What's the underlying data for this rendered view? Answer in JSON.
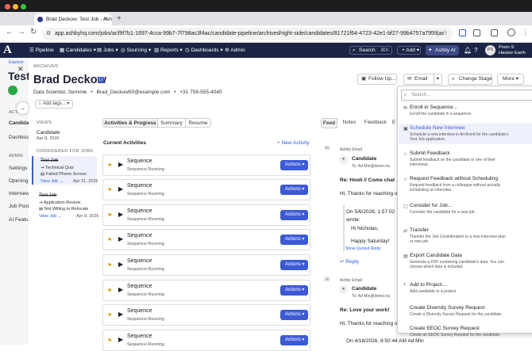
{
  "browser": {
    "tab_title": "Brad Deckow: Test Job - Ash",
    "url": "app.ashbyhq.com/jobs/acf9f7b1-1697-4cca-99b7-7f798ac3f4ac/candidate-pipeline/archived/right-side/candidates/81721f64-4723-42e1-bf27-99b4757a7959|ar"
  },
  "app_nav": {
    "logo": "A",
    "items": [
      "Pipeline",
      "Candidates",
      "Jobs",
      "Sourcing",
      "Reports",
      "Dashboards",
      "Admin"
    ],
    "search_label": "Search",
    "search_shortcut": "⌘K",
    "add_label": "Add",
    "ai_label": "Ashby AI",
    "avatar_initials": "PS",
    "user_name": "Prem S",
    "user_org": "Hacker Earth"
  },
  "left_app": {
    "top_label": "Explore",
    "heading_fragment": "Test",
    "section": "ACTI",
    "items": [
      "Candidat",
      "Dashboa"
    ],
    "admin_label": "ADMIN",
    "admin_items": [
      "Settings",
      "Openings",
      "Interview",
      "Job Postin",
      "AI Featur"
    ]
  },
  "candidate": {
    "archived_label": "ARCHIVED",
    "name": "Brad Deckow",
    "badge": "LI",
    "role": "Data Scientist, Semmle",
    "email": "Brad_Deckow50@example.com",
    "phone": "+31 758-555-4040",
    "add_tags": "Add tags..."
  },
  "header_buttons": {
    "follow_up": "Follow Up...",
    "email": "Email",
    "change_stage": "Change Stage",
    "more": "More"
  },
  "views": {
    "heading": "VIEWS",
    "candidate_label": "Candidate",
    "candidate_date": "Apr 8, 2026",
    "considered_heading": "CONSIDERED FOR JOBS",
    "jobs": [
      {
        "title": "Test Job",
        "line1": "Technical Quiz",
        "line2": "Failed Phone Screen",
        "link": "View Job →",
        "date": "Apr 21, 2026"
      },
      {
        "title": "Test Job",
        "line1": "Application Review",
        "line2": "Not Willing to Relocate",
        "link": "View Job →",
        "date": "Apr 8, 2026"
      }
    ]
  },
  "center": {
    "tabs": [
      "Activities & Progress",
      "Summary",
      "Resume"
    ],
    "current_activities": "Current Activities",
    "new_activity": "+ New Activity",
    "rows": [
      {
        "title": "Sequence",
        "status": "Sequence Running",
        "action": "Actions"
      },
      {
        "title": "Sequence",
        "status": "Sequence Running",
        "action": "Actions"
      },
      {
        "title": "Sequence",
        "status": "Sequence Running",
        "action": "Actions"
      },
      {
        "title": "Sequence",
        "status": "Sequence Running",
        "action": "Actions"
      },
      {
        "title": "Sequence",
        "status": "Sequence Running",
        "action": "Actions"
      },
      {
        "title": "Sequence",
        "status": "Sequence Running",
        "action": "Actions"
      },
      {
        "title": "Sequence",
        "status": "Sequence Running",
        "action": "Actions"
      },
      {
        "title": "Sequence",
        "status": "Sequence Running",
        "action": "Actions"
      }
    ]
  },
  "feed": {
    "tabs": [
      "Feed",
      "Notes",
      "Feedback",
      "E"
    ],
    "card1": {
      "sender_label": "Ashby Email",
      "from": "Candidate",
      "to": "To: Ad Min@demo.ha",
      "subject": "Re: Hooli // Come chat",
      "body": "Hi, Thanks for reaching o",
      "quote_header": "On 5/6/2026, 1:57:02",
      "quote_wrote": "wrote:",
      "quote_greeting": "Hi Nicholas,",
      "quote_body": "Happy Saturday!",
      "show_quoted": "Show Quoted Reply",
      "reply": "Reply"
    },
    "card2": {
      "sender_label": "Ashby Email",
      "from": "Candidate",
      "to": "To: Ad Min@demo.ha",
      "subject": "Re: Love your work!",
      "body": "Hi, Thanks for reaching o",
      "quote_header": "On 4/18/2026, 8:50:44 AM Ad Min"
    }
  },
  "more_menu": {
    "search_placeholder": "Search...",
    "items": [
      {
        "icon": "✉",
        "title": "Enroll in Sequence...",
        "desc": "Enroll the candidate in a sequence."
      },
      {
        "icon": "▣",
        "title": "Schedule New Interview",
        "desc": "Schedule a new interview in Archived for the candidate's Test Job application."
      },
      {
        "icon": "☆",
        "title": "Submit Feedback",
        "desc": "Submit feedback on the candidate or one of their interviews."
      },
      {
        "icon": "☆",
        "title": "Request Feedback without Scheduling",
        "desc": "Request feedback from a colleague without actually scheduling an interview."
      },
      {
        "icon": "▢",
        "title": "Consider for Job...",
        "desc": "Consider the candidate for a new job."
      },
      {
        "icon": "⇄",
        "title": "Transfer",
        "desc": "Transfer the Job Consideration to a new interview plan or new job."
      },
      {
        "icon": "▤",
        "title": "Export Candidate Data",
        "desc": "Generate a PDF containing candidate's data. You can choose which data is included"
      },
      {
        "icon": "+",
        "title": "Add to Project...",
        "desc": "Add candidate to a project."
      },
      {
        "icon": "",
        "title": "Create Diversity Survey Request",
        "desc": "Create a Diversity Survey Request for the candidate."
      },
      {
        "icon": "",
        "title": "Create EEOC Survey Request",
        "desc": "Create an EEOC Survey Request for the candidate."
      }
    ]
  },
  "colors": {
    "nav_bg": "#1c2446",
    "primary": "#3c59d6",
    "highlight": "#eef1fb"
  }
}
